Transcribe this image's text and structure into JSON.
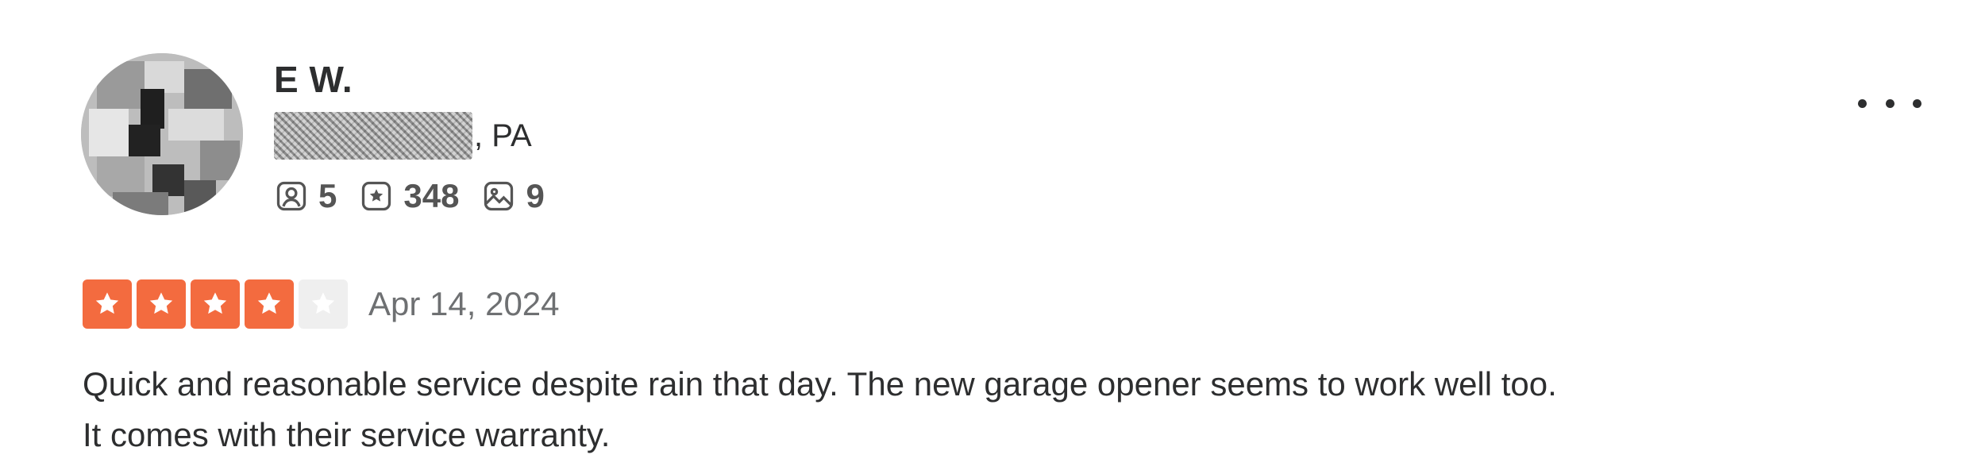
{
  "reviewer": {
    "name": "E W.",
    "location_suffix": ", PA",
    "stats": {
      "friends": "5",
      "reviews": "348",
      "photos": "9"
    }
  },
  "rating": {
    "stars": 4,
    "max_stars": 5,
    "date": "Apr 14, 2024"
  },
  "review": {
    "line1": "Quick and reasonable service despite rain that day. The new garage opener seems to work well too.",
    "line2": "It comes with their service warranty."
  },
  "icons": {
    "friends": "friends-icon",
    "reviews": "review-star-icon",
    "photos": "photo-icon",
    "more": "more-options-icon"
  },
  "colors": {
    "star_active": "#f36b3f",
    "star_inactive": "#efefef",
    "text": "#2d2e2f",
    "muted": "#6e7072"
  }
}
